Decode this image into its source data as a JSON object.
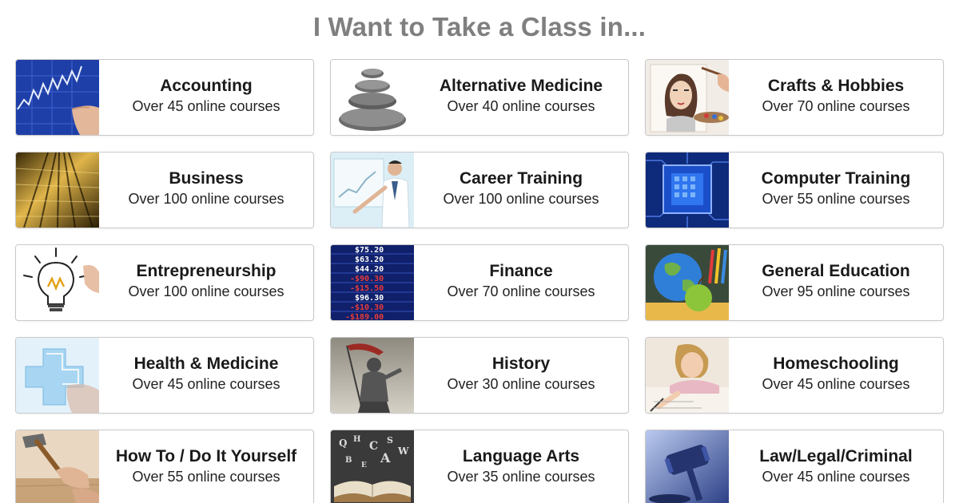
{
  "page": {
    "title": "I Want to Take a Class in..."
  },
  "categories": [
    {
      "title": "Accounting",
      "subtitle": "Over 45 online courses",
      "icon": "stock-chart-thumbnail"
    },
    {
      "title": "Alternative Medicine",
      "subtitle": "Over 40 online courses",
      "icon": "stacked-stones-thumbnail"
    },
    {
      "title": "Crafts & Hobbies",
      "subtitle": "Over 70 online courses",
      "icon": "painting-portrait-thumbnail"
    },
    {
      "title": "Business",
      "subtitle": "Over 100 online courses",
      "icon": "skyscraper-thumbnail"
    },
    {
      "title": "Career Training",
      "subtitle": "Over 100 online courses",
      "icon": "presenter-thumbnail"
    },
    {
      "title": "Computer Training",
      "subtitle": "Over 55 online courses",
      "icon": "microchip-thumbnail"
    },
    {
      "title": "Entrepreneurship",
      "subtitle": "Over 100 online courses",
      "icon": "lightbulb-thumbnail"
    },
    {
      "title": "Finance",
      "subtitle": "Over 70 online courses",
      "icon": "stock-ticker-board-thumbnail"
    },
    {
      "title": "General Education",
      "subtitle": "Over 95 online courses",
      "icon": "globe-apple-thumbnail"
    },
    {
      "title": "Health & Medicine",
      "subtitle": "Over 45 online courses",
      "icon": "medical-cross-thumbnail"
    },
    {
      "title": "History",
      "subtitle": "Over 30 online courses",
      "icon": "knight-statue-thumbnail"
    },
    {
      "title": "Homeschooling",
      "subtitle": "Over 45 online courses",
      "icon": "child-writing-thumbnail"
    },
    {
      "title": "How To / Do It Yourself",
      "subtitle": "Over 55 online courses",
      "icon": "hammer-thumbnail"
    },
    {
      "title": "Language Arts",
      "subtitle": "Over 35 online courses",
      "icon": "open-book-letters-thumbnail"
    },
    {
      "title": "Law/Legal/Criminal",
      "subtitle": "Over 45 online courses",
      "icon": "gavel-thumbnail"
    }
  ],
  "thumbnail_text": {
    "finance_ticker": [
      "$75.20",
      "$63.20",
      "$44.20",
      "-$90.30",
      "-$15.50",
      "$96.30",
      "-$10.30",
      "-$189.00"
    ]
  },
  "colors": {
    "title_gray": "#7f7f7f",
    "card_border": "#c9c9c9",
    "accounting_blue": "#1f3fa8",
    "chip_blue": "#1b4fc9",
    "ticker_red": "#e83b3b",
    "gavel_blue": "#2c3f86"
  }
}
